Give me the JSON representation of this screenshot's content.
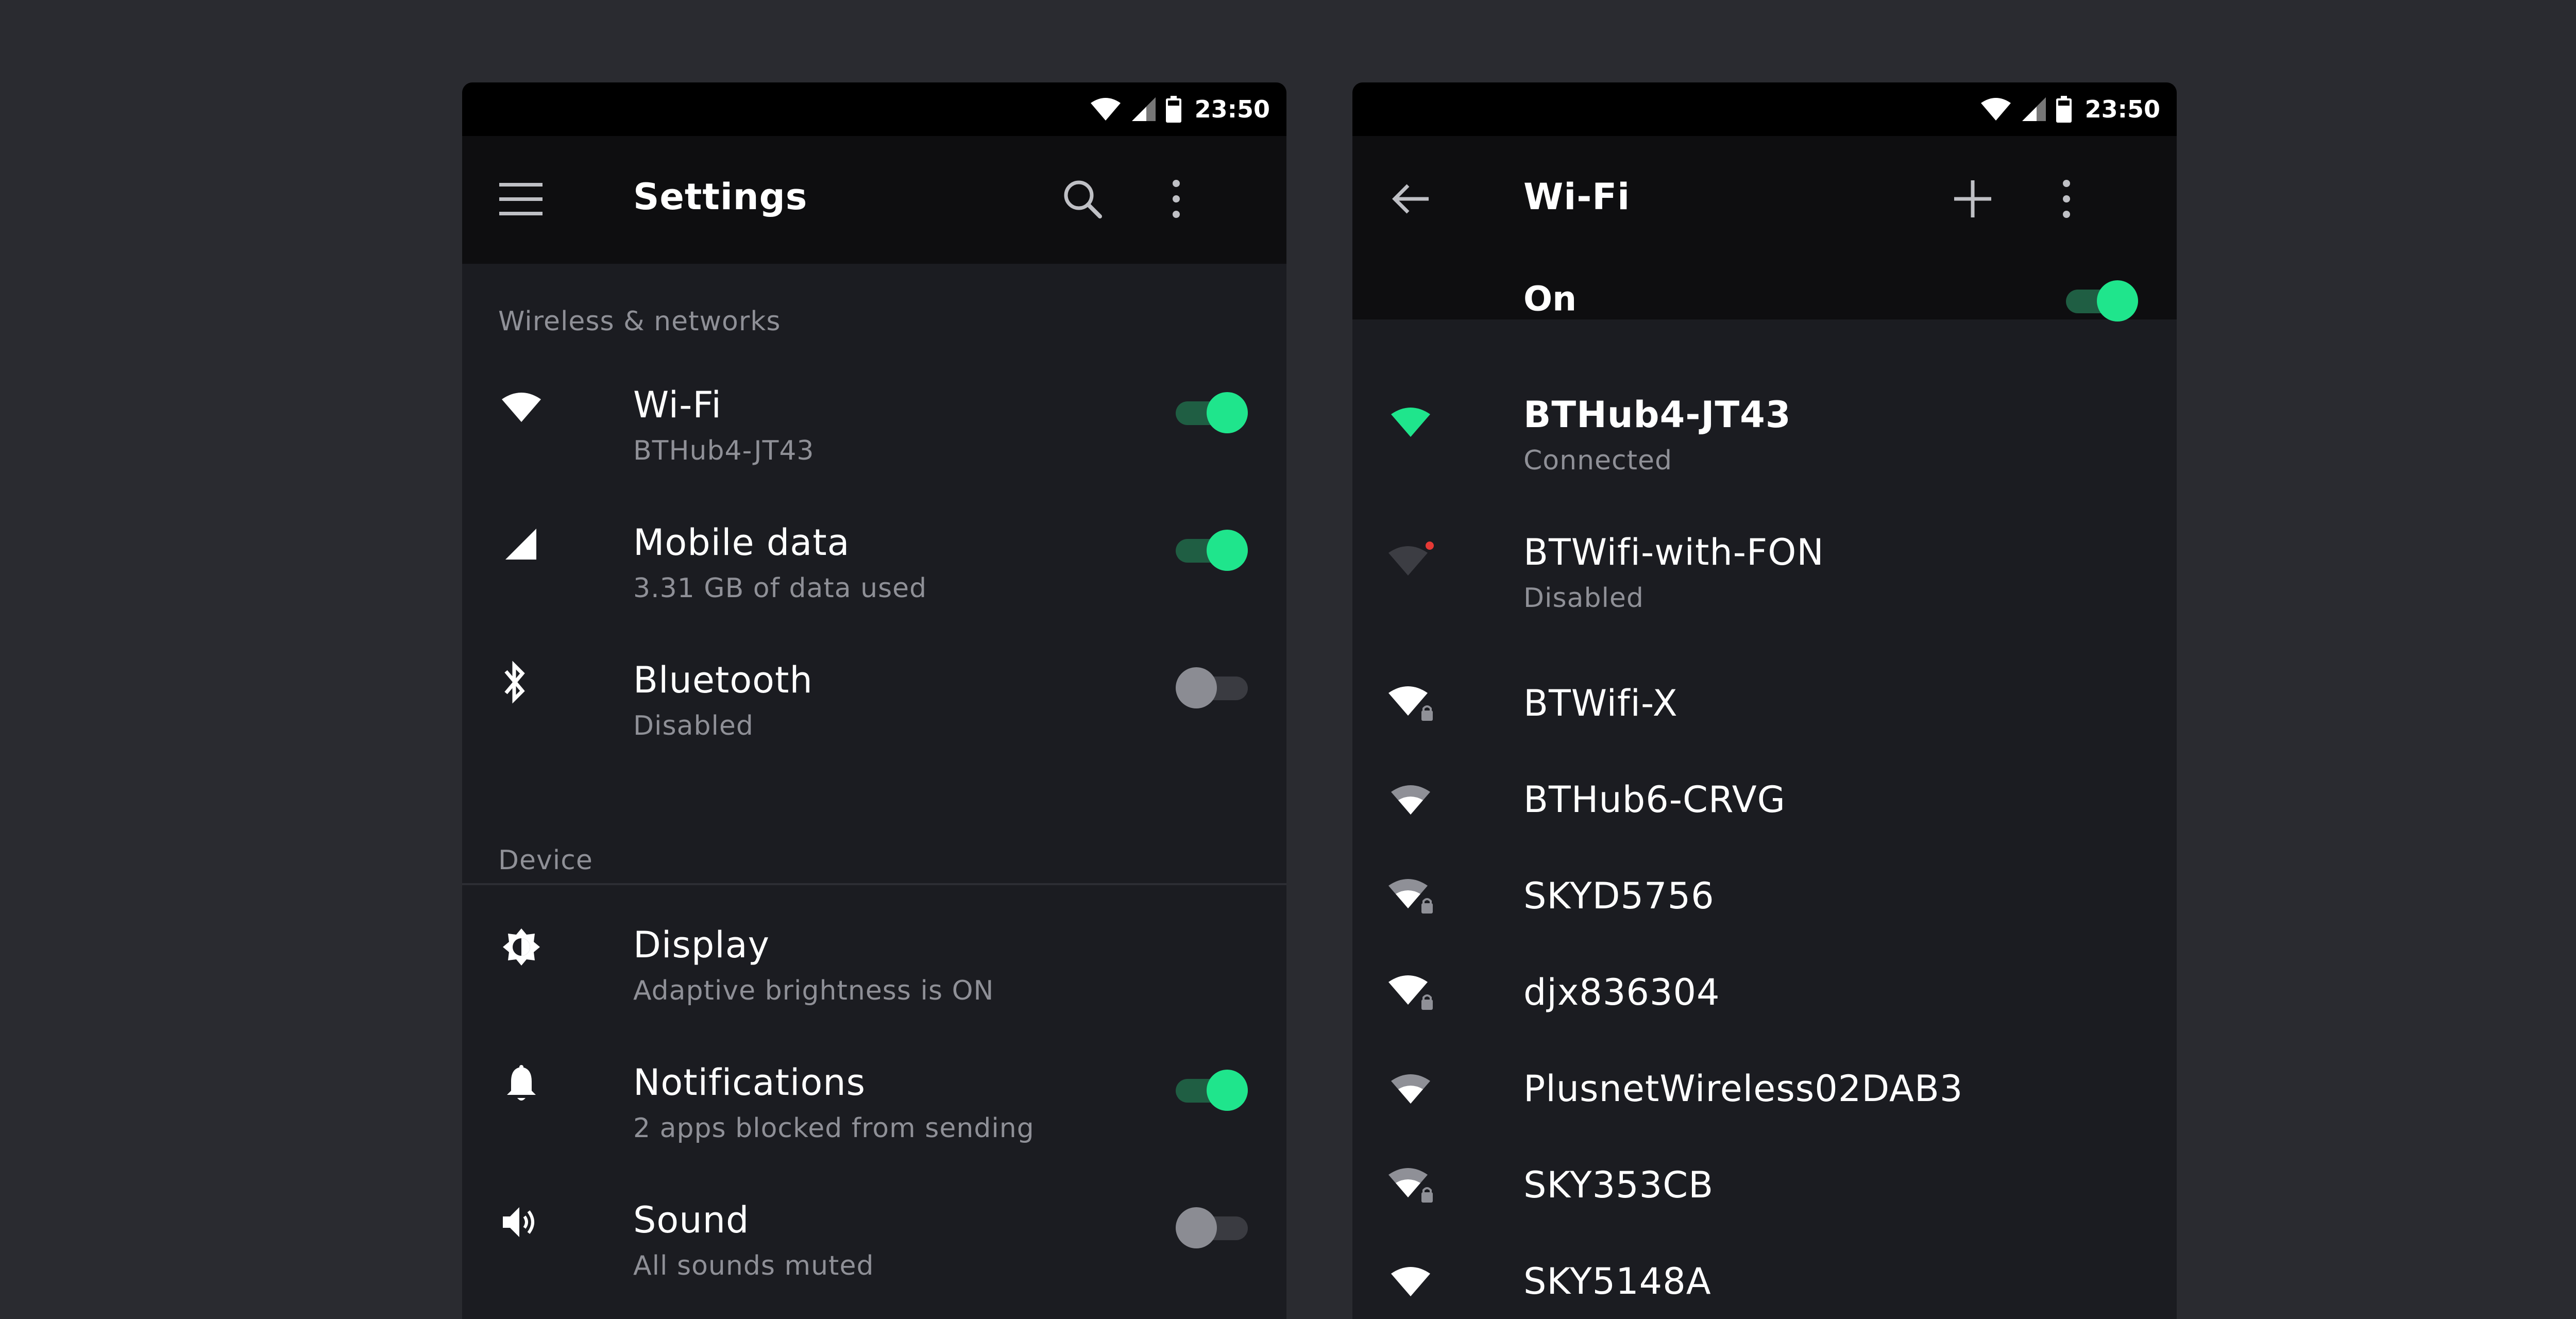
{
  "colors": {
    "background": "#2a2b30",
    "panel": "#1b1c21",
    "appbar": "#0e0e10",
    "statusbar": "#000000",
    "accent": "#1fe58c",
    "accent_track": "#1f5e43",
    "secondary_text": "#8f9097",
    "error_dot": "#e53935"
  },
  "statusbar": {
    "time_left": "23:50",
    "time_right": "23:50",
    "icons": [
      "wifi-icon",
      "signal-icon",
      "battery-icon"
    ]
  },
  "settings": {
    "title": "Settings",
    "menu_icon": "menu-icon",
    "search_icon": "search-icon",
    "overflow_icon": "more-vert-icon",
    "sections": [
      {
        "header": "Wireless & networks",
        "items": [
          {
            "icon": "wifi-icon",
            "title": "Wi-Fi",
            "subtitle": "BTHub4-JT43",
            "toggle": true
          },
          {
            "icon": "signal-icon",
            "title": "Mobile data",
            "subtitle": "3.31 GB of data used",
            "toggle": true
          },
          {
            "icon": "bluetooth-icon",
            "title": "Bluetooth",
            "subtitle": "Disabled",
            "toggle": false
          }
        ]
      },
      {
        "header": "Device",
        "items": [
          {
            "icon": "brightness-icon",
            "title": "Display",
            "subtitle": "Adaptive brightness is ON",
            "toggle": null
          },
          {
            "icon": "bell-icon",
            "title": "Notifications",
            "subtitle": "2 apps blocked from sending",
            "toggle": true
          },
          {
            "icon": "volume-icon",
            "title": "Sound",
            "subtitle": "All sounds muted",
            "toggle": false
          }
        ]
      }
    ]
  },
  "wifi": {
    "title": "Wi-Fi",
    "back_icon": "arrow-back-icon",
    "add_icon": "add-icon",
    "overflow_icon": "more-vert-icon",
    "master_label": "On",
    "master_on": true,
    "networks": [
      {
        "name": "BTHub4-JT43",
        "status": "Connected",
        "icon": "wifi-connected-icon",
        "secured": false
      },
      {
        "name": "BTWifi-with-FON",
        "status": "Disabled",
        "icon": "wifi-disabled-icon",
        "secured": false
      },
      {
        "name": "BTWifi-X",
        "status": "",
        "icon": "wifi-lock-icon",
        "secured": true
      },
      {
        "name": "BTHub6-CRVG",
        "status": "",
        "icon": "wifi-icon",
        "secured": false
      },
      {
        "name": "SKYD5756",
        "status": "",
        "icon": "wifi-lock-icon",
        "secured": true
      },
      {
        "name": "djx836304",
        "status": "",
        "icon": "wifi-lock-icon",
        "secured": true
      },
      {
        "name": "PlusnetWireless02DAB3",
        "status": "",
        "icon": "wifi-icon",
        "secured": false
      },
      {
        "name": "SKY353CB",
        "status": "",
        "icon": "wifi-lock-icon",
        "secured": true
      },
      {
        "name": "SKY5148A",
        "status": "",
        "icon": "wifi-icon",
        "secured": false
      }
    ]
  }
}
